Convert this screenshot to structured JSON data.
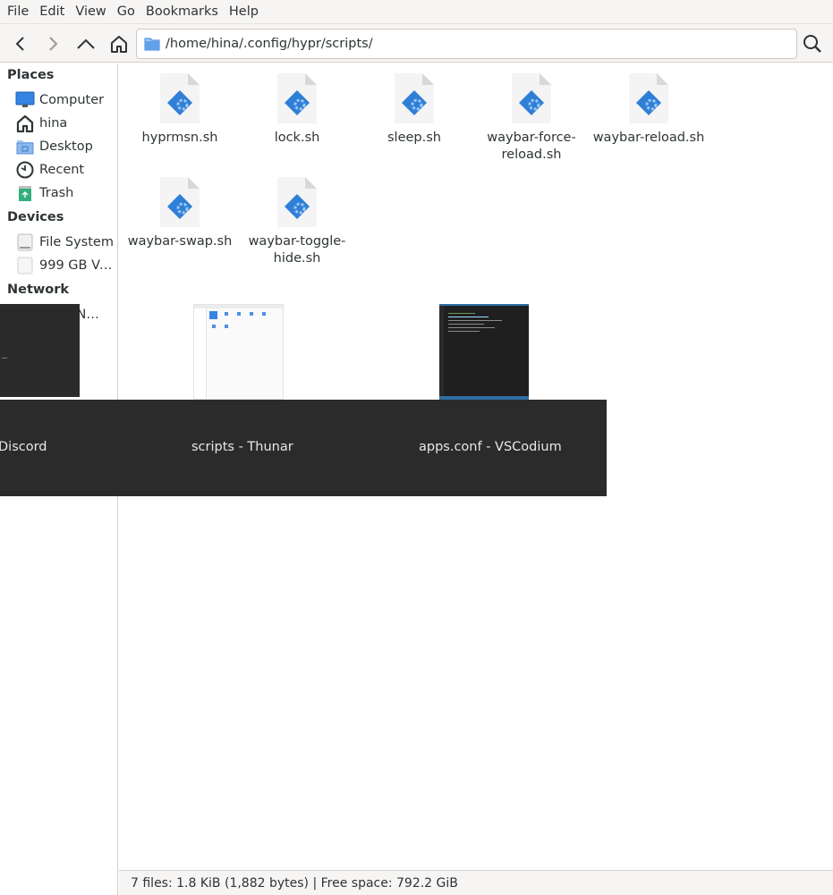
{
  "menubar": {
    "items": [
      "File",
      "Edit",
      "View",
      "Go",
      "Bookmarks",
      "Help"
    ]
  },
  "toolbar": {
    "back_icon": "chevron-left-icon",
    "forward_icon": "chevron-right-icon",
    "up_icon": "chevron-up-icon",
    "home_icon": "home-icon",
    "location": "/home/hina/.config/hypr/scripts/",
    "search_icon": "search-icon"
  },
  "sidebar": {
    "places_heading": "Places",
    "places": [
      {
        "label": "Computer",
        "icon": "computer-icon"
      },
      {
        "label": "hina",
        "icon": "home-icon"
      },
      {
        "label": "Desktop",
        "icon": "desktop-folder-icon"
      },
      {
        "label": "Recent",
        "icon": "clock-icon"
      },
      {
        "label": "Trash",
        "icon": "trash-icon"
      }
    ],
    "devices_heading": "Devices",
    "devices": [
      {
        "label": "File System",
        "icon": "drive-icon"
      },
      {
        "label": "999 GB Vo…",
        "icon": "drive-icon"
      }
    ],
    "network_heading": "Network",
    "network": [
      {
        "label": "e N…",
        "icon": "network-icon"
      }
    ]
  },
  "files": [
    {
      "name": "hyprmsn.sh",
      "icon": "shell-script-icon"
    },
    {
      "name": "lock.sh",
      "icon": "shell-script-icon"
    },
    {
      "name": "sleep.sh",
      "icon": "shell-script-icon"
    },
    {
      "name": "waybar-force-reload.sh",
      "icon": "shell-script-icon"
    },
    {
      "name": "waybar-reload.sh",
      "icon": "shell-script-icon"
    },
    {
      "name": "waybar-swap.sh",
      "icon": "shell-script-icon"
    },
    {
      "name": "waybar-toggle-hide.sh",
      "icon": "shell-script-icon"
    }
  ],
  "status": "7 files: 1.8 KiB (1,882 bytes) | Free space: 792.2 GiB",
  "window_switcher": {
    "windows": [
      {
        "title": "Discord"
      },
      {
        "title": "scripts - Thunar"
      },
      {
        "title": "apps.conf - VSCodium"
      }
    ]
  },
  "colors": {
    "accent": "#3584e4",
    "switcher_bg": "#2b2b2b"
  }
}
